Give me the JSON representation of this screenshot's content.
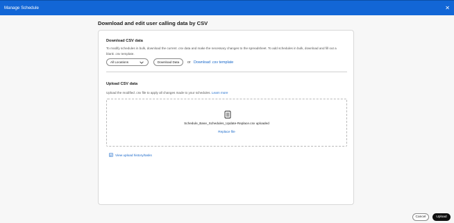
{
  "window": {
    "title": "Manage Schedule",
    "close_icon": "close-icon"
  },
  "page": {
    "heading": "Download and edit user calling data by CSV"
  },
  "download": {
    "title": "Download CSV data",
    "description": "To modify schedules in bulk, download the current .csv data and make the necessary changes to the spreadsheet. To add schedules in bulk, download and fill out a blank .csv template.",
    "location_select": "All Locations",
    "download_button": "Download Data",
    "or_text": "or",
    "template_link": "Download .csv template"
  },
  "upload": {
    "title": "Upload CSV data",
    "description": "Upload the modified .csv file to apply all changes made to your schedules.",
    "learn_more": "Learn more",
    "file_icon": "document-icon",
    "filename": "Schedule_Base_Schedules_Update-Replace.csv uploaded",
    "replace_link": "Replace file",
    "history_link": "View upload history/tasks"
  },
  "footer": {
    "cancel_label": "Cancel",
    "upload_label": "Upload"
  },
  "colors": {
    "titlebar": "#1266d6",
    "link": "#1566c9",
    "primary_button": "#111111"
  }
}
